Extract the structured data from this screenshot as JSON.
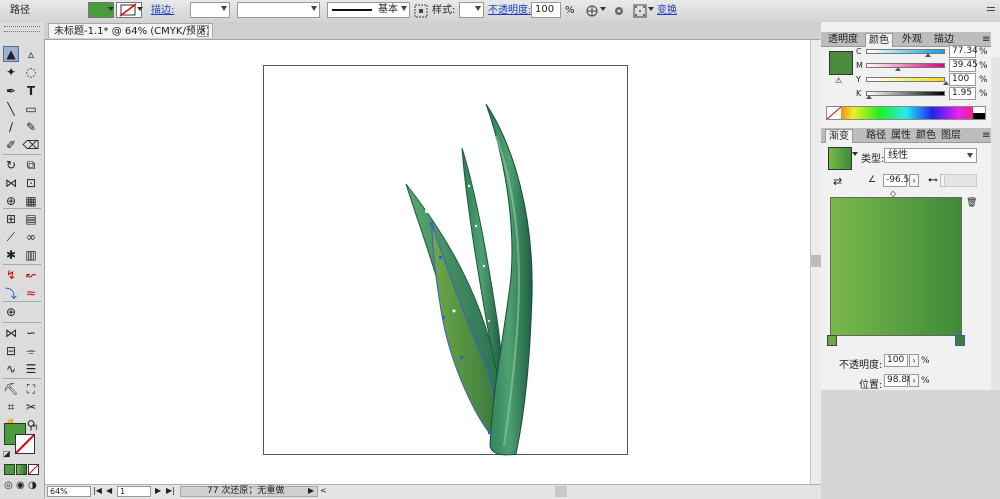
{
  "control_bar": {
    "object_label": "路径",
    "stroke_label": "描边:",
    "stroke_profile_label": "基本",
    "style_label": "样式:",
    "opacity_label": "不透明度:",
    "opacity_value": "100",
    "opacity_unit": "%",
    "transform_label": "变换"
  },
  "document_tab": {
    "title": "未标题-1.1* @ 64% (CMYK/预览)",
    "close_glyph": "✕"
  },
  "status": {
    "zoom": "64%",
    "page": "1",
    "undo_text": "77 次还原；无重做"
  },
  "color_panel": {
    "tabs": [
      "透明度",
      "颜色",
      "外观",
      "描边"
    ],
    "active_tab": "颜色",
    "channels": [
      {
        "name": "C",
        "value": "77.34",
        "unit": "%"
      },
      {
        "name": "M",
        "value": "39.45",
        "unit": "%"
      },
      {
        "name": "Y",
        "value": "100",
        "unit": "%"
      },
      {
        "name": "K",
        "value": "1.95",
        "unit": "%"
      }
    ],
    "fill_color": "#4a8a3c"
  },
  "gradient_panel": {
    "tabs": [
      "渐变",
      "路径",
      "属性",
      "颜色",
      "图层"
    ],
    "active_tab": "渐变",
    "type_label": "类型:",
    "type_value": "线性",
    "angle_value": "-96.5",
    "opacity_label": "不透明度:",
    "opacity_value": "100",
    "opacity_unit": "%",
    "position_label": "位置:",
    "position_value": "98.88",
    "position_unit": "%",
    "start_color": "#7ab84a",
    "end_color": "#3f8a3a"
  },
  "colors": {
    "accent_fill": "#4a9a3e",
    "leaf_dark": "#1f6b4a",
    "leaf_light": "#5aa268"
  }
}
